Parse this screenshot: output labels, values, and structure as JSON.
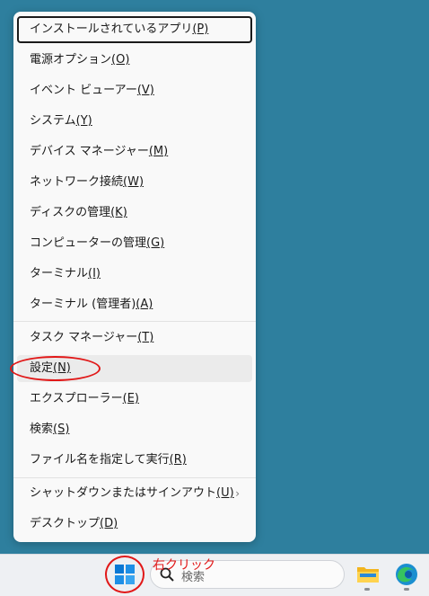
{
  "menu": {
    "items": [
      {
        "label": "インストールされているアプリ",
        "key": "(P)"
      },
      {
        "label": "電源オプション",
        "key": "(O)"
      },
      {
        "label": "イベント ビューアー",
        "key": "(V)"
      },
      {
        "label": "システム",
        "key": "(Y)"
      },
      {
        "label": "デバイス マネージャー",
        "key": "(M)"
      },
      {
        "label": "ネットワーク接続",
        "key": "(W)"
      },
      {
        "label": "ディスクの管理",
        "key": "(K)"
      },
      {
        "label": "コンピューターの管理",
        "key": "(G)"
      },
      {
        "label": "ターミナル",
        "key": "(I)"
      },
      {
        "label": "ターミナル (管理者)",
        "key": "(A)"
      },
      {
        "label": "タスク マネージャー",
        "key": "(T)"
      },
      {
        "label": "設定",
        "key": "(N)"
      },
      {
        "label": "エクスプローラー",
        "key": "(E)"
      },
      {
        "label": "検索",
        "key": "(S)"
      },
      {
        "label": "ファイル名を指定して実行",
        "key": "(R)"
      },
      {
        "label": "シャットダウンまたはサインアウト",
        "key": "(U)"
      },
      {
        "label": "デスクトップ",
        "key": "(D)"
      }
    ],
    "submenu_glyph": "›"
  },
  "taskbar": {
    "search_placeholder": "検索",
    "start_icon": "windows-start-icon",
    "pinned": [
      "folder-icon",
      "edge-icon"
    ]
  },
  "annotation": {
    "text": "右クリック",
    "color": "#e11818"
  },
  "colors": {
    "desktop": "#2e7f9e",
    "menu": "#f9f9f9",
    "accent_red": "#e11818"
  }
}
